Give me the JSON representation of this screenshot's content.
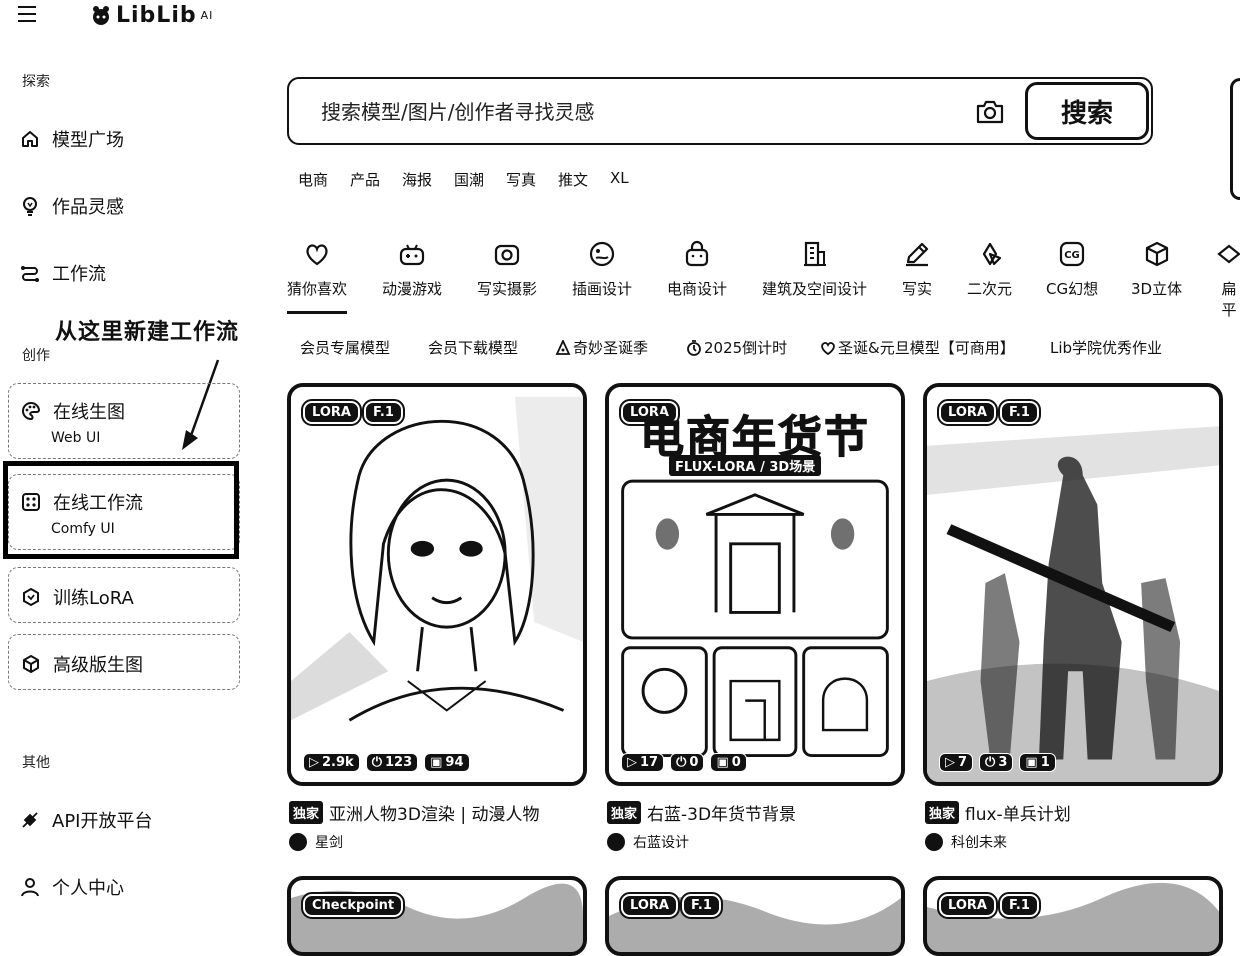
{
  "brand": {
    "name": "LibLib",
    "suffix": "AI"
  },
  "sidebar": {
    "explore_label": "探索",
    "explore_items": [
      {
        "label": "模型广场",
        "icon": "home-icon"
      },
      {
        "label": "作品灵感",
        "icon": "bulb-icon"
      },
      {
        "label": "工作流",
        "icon": "workflow-icon"
      }
    ],
    "create_label": "创作",
    "create_items": [
      {
        "label": "在线生图",
        "sub": "Web UI",
        "icon": "palette-icon"
      },
      {
        "label": "在线工作流",
        "sub": "Comfy UI",
        "icon": "comfy-icon"
      },
      {
        "label": "训练LoRA",
        "icon": "hexagon-icon"
      },
      {
        "label": "高级版生图",
        "icon": "cube-icon"
      }
    ],
    "other_label": "其他",
    "other_items": [
      {
        "label": "API开放平台",
        "icon": "api-icon"
      },
      {
        "label": "个人中心",
        "icon": "user-icon"
      }
    ]
  },
  "annotation": "从这里新建工作流",
  "search": {
    "placeholder": "搜索模型/图片/创作者寻找灵感",
    "button": "搜索",
    "tags": [
      "电商",
      "产品",
      "海报",
      "国潮",
      "写真",
      "推文",
      "XL"
    ]
  },
  "categories": [
    {
      "label": "猜你喜欢",
      "icon": "heart-icon",
      "active": true
    },
    {
      "label": "动漫游戏",
      "icon": "gamepad-icon"
    },
    {
      "label": "写实摄影",
      "icon": "camera-icon"
    },
    {
      "label": "插画设计",
      "icon": "palette-icon"
    },
    {
      "label": "电商设计",
      "icon": "shopping-bag-icon"
    },
    {
      "label": "建筑及空间设计",
      "icon": "building-icon"
    },
    {
      "label": "写实",
      "icon": "pencil-icon"
    },
    {
      "label": "二次元",
      "icon": "clover-icon"
    },
    {
      "label": "CG幻想",
      "icon": "cg-icon"
    },
    {
      "label": "3D立体",
      "icon": "cube-icon"
    },
    {
      "label": "扁平",
      "icon": "flat-icon"
    }
  ],
  "chips": [
    {
      "label": "会员专属模型"
    },
    {
      "label": "会员下载模型"
    },
    {
      "label": "奇妙圣诞季",
      "icon": "tree-icon"
    },
    {
      "label": "2025倒计时",
      "icon": "timer-icon"
    },
    {
      "label": "圣诞&元旦模型【可商用】",
      "icon": "heart-icon"
    },
    {
      "label": "Lib学院优秀作业"
    }
  ],
  "cards": [
    {
      "badges": [
        "LORA",
        "F.1"
      ],
      "stats": {
        "runs": "2.9k",
        "downloads": "123",
        "images": "94"
      },
      "exclusive": "独家",
      "title": "亚洲人物3D渲染 | 动漫人物",
      "author": "星剑"
    },
    {
      "badges": [
        "LORA"
      ],
      "poster_title": "电商年货节",
      "poster_sub": "FLUX-LORA / 3D场景",
      "stats": {
        "runs": "17",
        "downloads": "0",
        "images": "0"
      },
      "exclusive": "独家",
      "title": "右蓝-3D年货节背景",
      "author": "右蓝设计"
    },
    {
      "badges": [
        "LORA",
        "F.1"
      ],
      "stats": {
        "runs": "7",
        "downloads": "3",
        "images": "1"
      },
      "exclusive": "独家",
      "title": "flux-单兵计划",
      "author": "科创未来"
    }
  ],
  "partial_cards": [
    {
      "badges": [
        "Checkpoint"
      ]
    },
    {
      "badges": [
        "LORA",
        "F.1"
      ]
    },
    {
      "badges": [
        "LORA",
        "F.1"
      ]
    }
  ]
}
